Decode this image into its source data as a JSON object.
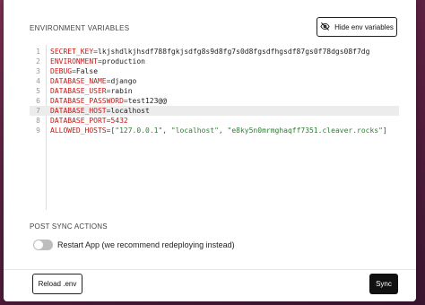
{
  "env_section": {
    "title": "ENVIRONMENT VARIABLES",
    "hide_button_label": "Hide env variables",
    "lines": [
      {
        "num": "1",
        "key": "SECRET_KEY",
        "value": "lkjshdlkjhsdf788fgkjsdfg8s9d8fg7s0d8fgsdfhgsdf87gs0f78dgs08f7dg"
      },
      {
        "num": "2",
        "key": "ENVIRONMENT",
        "value": "production"
      },
      {
        "num": "3",
        "key": "DEBUG",
        "value": "False"
      },
      {
        "num": "4",
        "key": "DATABASE_NAME",
        "value": "django"
      },
      {
        "num": "5",
        "key": "DATABASE_USER",
        "value": "rabin"
      },
      {
        "num": "6",
        "key": "DATABASE_PASSWORD",
        "value": "test123@@"
      },
      {
        "num": "7",
        "key": "DATABASE_HOST",
        "value": "localhost"
      },
      {
        "num": "8",
        "key": "DATABASE_PORT",
        "value": "5432"
      },
      {
        "num": "9",
        "key": "ALLOWED_HOSTS",
        "value_parts": [
          "[",
          "\"127.0.0.1\"",
          ", ",
          "\"localhost\"",
          ", ",
          "\"e8ky5n0mrmghaqff7351.cleaver.rocks\"",
          "]"
        ]
      }
    ],
    "active_line": 7
  },
  "post_sync": {
    "title": "POST SYNC ACTIONS",
    "toggle_label": "Restart App (we recommend redeploying instead)",
    "toggle_on": false
  },
  "footer": {
    "reload_label": "Reload .env",
    "sync_label": "Sync"
  },
  "colors": {
    "key": "#c41a16",
    "string": "#2e7d32",
    "primary_button": "#111111"
  }
}
